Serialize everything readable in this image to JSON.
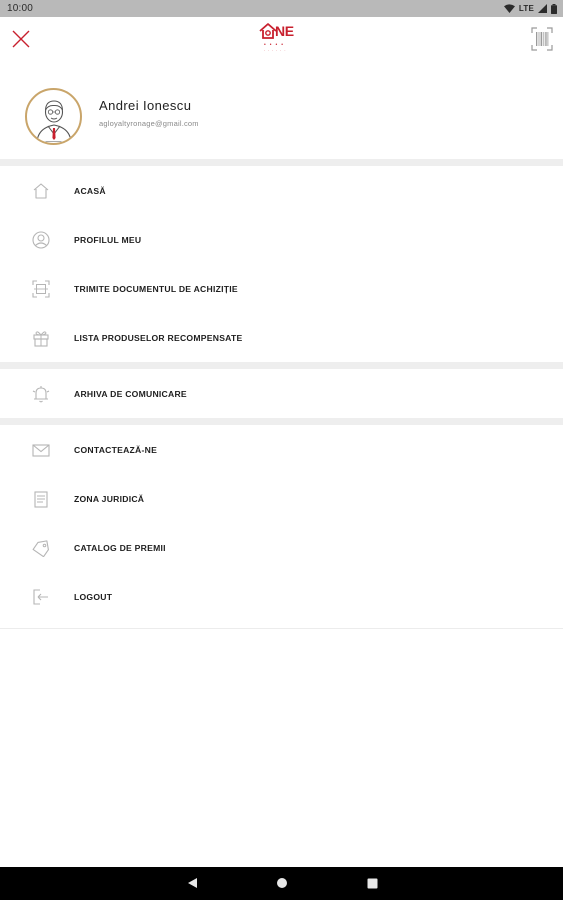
{
  "status_bar": {
    "time": "10:00",
    "network": "LTE"
  },
  "top_bar": {
    "logo_text": "NE",
    "logo_sub": "• • • •",
    "logo_sub2": "· · · · · ·"
  },
  "profile": {
    "name": "Andrei Ionescu",
    "email": "agloyaltyronage@gmail.com"
  },
  "menu": {
    "group1": [
      {
        "label": "ACASĂ",
        "icon": "home-icon"
      },
      {
        "label": "PROFILUL MEU",
        "icon": "user-icon"
      },
      {
        "label": "TRIMITE DOCUMENTUL DE ACHIZIȚIE",
        "icon": "scan-icon"
      },
      {
        "label": "LISTA PRODUSELOR RECOMPENSATE",
        "icon": "gift-icon"
      }
    ],
    "group2": [
      {
        "label": "ARHIVA DE COMUNICARE",
        "icon": "bell-icon"
      }
    ],
    "group3": [
      {
        "label": "CONTACTEAZĂ-NE",
        "icon": "mail-icon"
      },
      {
        "label": "ZONA JURIDICĂ",
        "icon": "document-icon"
      },
      {
        "label": "CATALOG DE PREMII",
        "icon": "tag-icon"
      },
      {
        "label": "LOGOUT",
        "icon": "logout-icon"
      }
    ]
  },
  "colors": {
    "accent": "#c8202e",
    "avatar_ring": "#c9a56a",
    "divider": "#eeeeee",
    "icon_gray": "#b5b5b5"
  }
}
